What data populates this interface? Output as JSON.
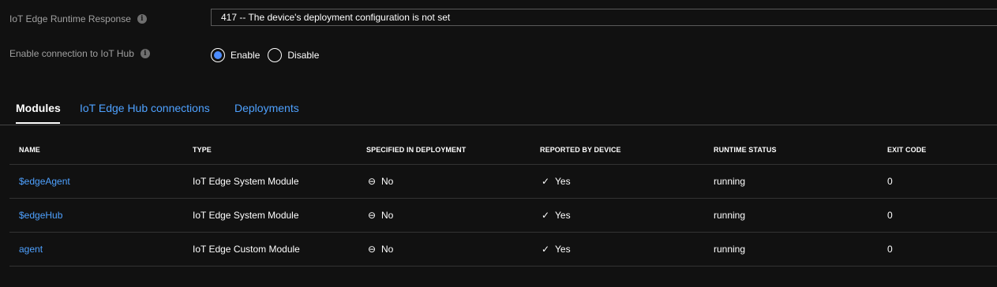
{
  "fields": {
    "runtime_response": {
      "label": "IoT Edge Runtime Response",
      "value": "417 -- The device's deployment configuration is not set"
    },
    "connection": {
      "label": "Enable connection to IoT Hub",
      "options": [
        {
          "label": "Enable",
          "checked": true
        },
        {
          "label": "Disable",
          "checked": false
        }
      ]
    }
  },
  "tabs": [
    {
      "label": "Modules",
      "active": true
    },
    {
      "label": "IoT Edge Hub connections",
      "active": false
    },
    {
      "label": "Deployments",
      "active": false
    }
  ],
  "table": {
    "columns": [
      "NAME",
      "TYPE",
      "SPECIFIED IN DEPLOYMENT",
      "REPORTED BY DEVICE",
      "RUNTIME STATUS",
      "EXIT CODE"
    ],
    "rows": [
      {
        "name": "$edgeAgent",
        "type": "IoT Edge System Module",
        "specified": "No",
        "reported": "Yes",
        "status": "running",
        "exit_code": "0"
      },
      {
        "name": "$edgeHub",
        "type": "IoT Edge System Module",
        "specified": "No",
        "reported": "Yes",
        "status": "running",
        "exit_code": "0"
      },
      {
        "name": "agent",
        "type": "IoT Edge Custom Module",
        "specified": "No",
        "reported": "Yes",
        "status": "running",
        "exit_code": "0"
      }
    ]
  },
  "icons": {
    "info": "info-icon",
    "specified": "minus-circle-icon",
    "reported": "checkmark-icon"
  },
  "colors": {
    "accent": "#4c8cff",
    "link": "#4ea1ff",
    "background": "#111111"
  }
}
